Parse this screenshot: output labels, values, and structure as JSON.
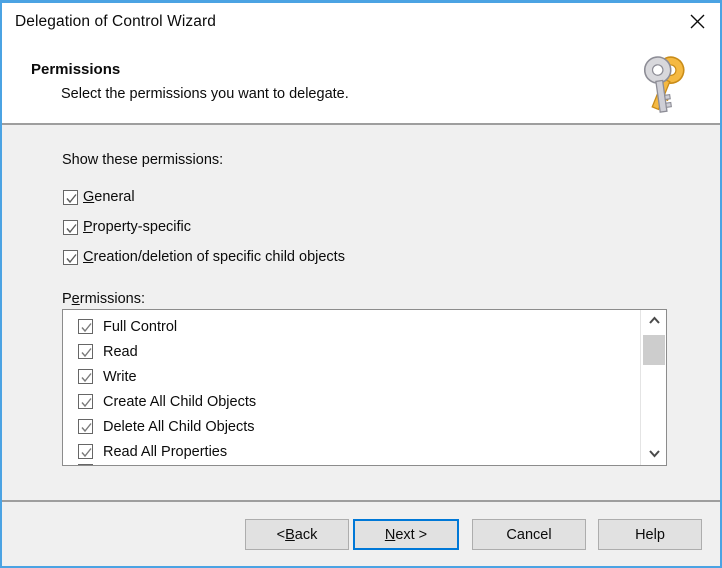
{
  "window": {
    "title": "Delegation of Control Wizard",
    "close_icon": "close-icon",
    "border_color": "#4ba3e3"
  },
  "header": {
    "title": "Permissions",
    "subtitle": "Select the permissions you want to delegate.",
    "icon": "keys-icon"
  },
  "body": {
    "show_permissions_label": "Show these permissions:",
    "filter_checkboxes": [
      {
        "label": "General",
        "accel": "G",
        "rest": "eneral",
        "checked": true
      },
      {
        "label": "Property-specific",
        "accel": "P",
        "rest": "roperty-specific",
        "checked": true
      },
      {
        "label": "Creation/deletion of specific child objects",
        "accel": "C",
        "rest": "reation/deletion of specific child objects",
        "checked": true
      }
    ],
    "permissions_label_pre": "P",
    "permissions_label_accel": "e",
    "permissions_label_post": "rmissions:",
    "permissions_list": [
      {
        "label": "Full Control",
        "checked": true
      },
      {
        "label": "Read",
        "checked": true
      },
      {
        "label": "Write",
        "checked": true
      },
      {
        "label": "Create All Child Objects",
        "checked": true
      },
      {
        "label": "Delete All Child Objects",
        "checked": true
      },
      {
        "label": "Read All Properties",
        "checked": true
      }
    ],
    "scrollbar": {
      "up_icon": "chevron-up-icon",
      "down_icon": "chevron-down-icon",
      "thumb": "scrollbar-thumb"
    }
  },
  "footer": {
    "buttons": [
      {
        "name": "back",
        "pre": "< ",
        "accel": "B",
        "post": "ack",
        "default": false
      },
      {
        "name": "next",
        "pre": "",
        "accel": "N",
        "post": "ext >",
        "default": true
      },
      {
        "name": "cancel",
        "pre": "",
        "accel": "",
        "post": "Cancel",
        "default": false
      },
      {
        "name": "help",
        "pre": "",
        "accel": "",
        "post": "Help",
        "default": false
      }
    ],
    "focus_color": "#0078d7"
  }
}
